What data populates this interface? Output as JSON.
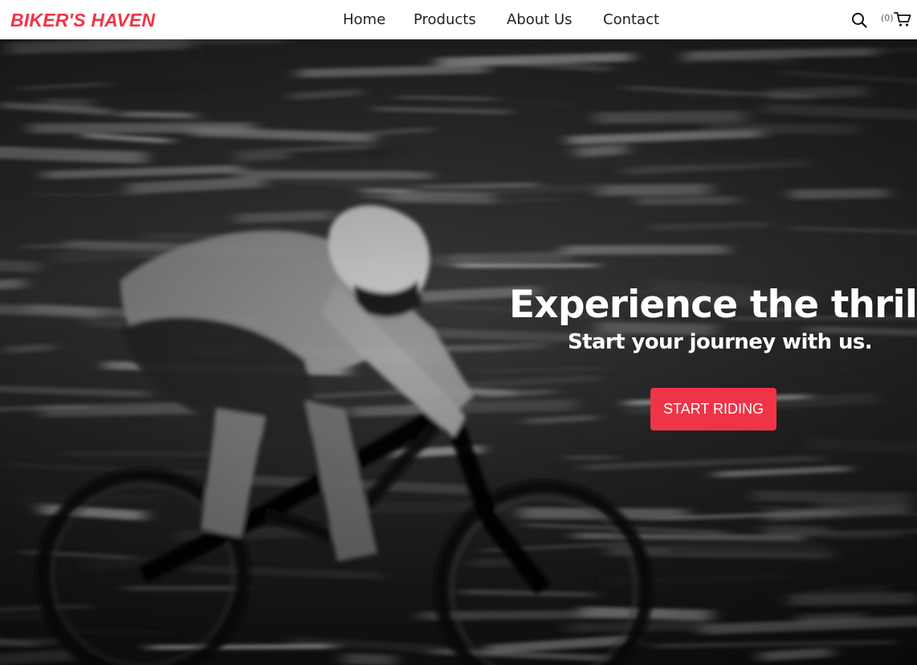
{
  "header": {
    "brand": "BIKER'S HAVEN",
    "nav": [
      "Home",
      "Products",
      "About Us",
      "Contact"
    ],
    "cart_count": "(0)",
    "icons": {
      "search": "search-icon",
      "cart": "cart-icon"
    }
  },
  "hero": {
    "heading": "Experience the thrill.",
    "subheading": "Start your journey with us.",
    "cta_label": "START RIDING",
    "image": "black-and-white motion-blurred photo of a mountain biker riding downhill"
  },
  "colors": {
    "accent": "#f03447",
    "nav_background": "#ffffff",
    "nav_text": "#222222",
    "hero_text": "#ffffff"
  }
}
